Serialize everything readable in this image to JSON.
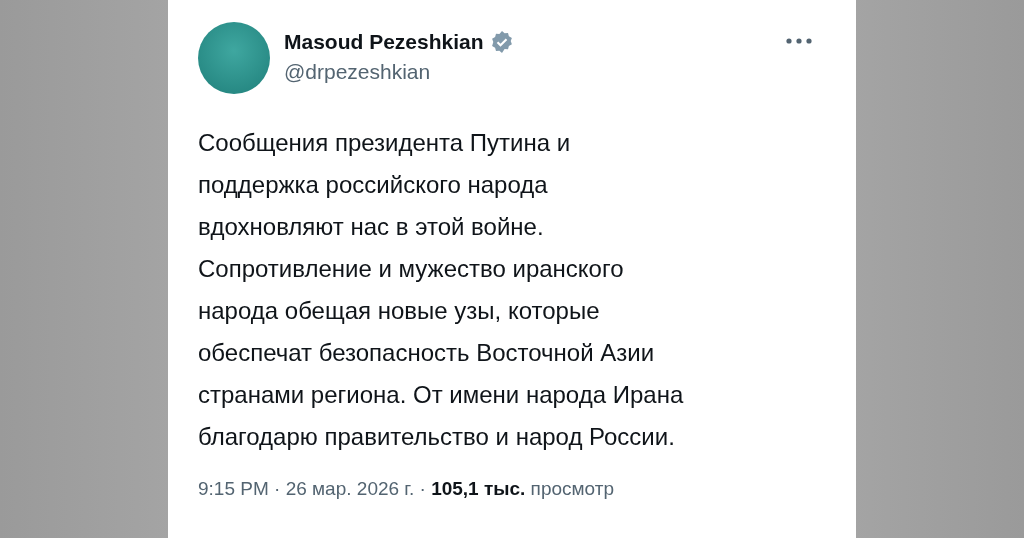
{
  "post": {
    "author": {
      "name": "Masoud Pezeshkian",
      "verified": true,
      "handle": "@drpezeshkian"
    },
    "text_lines": [
      "Сообщения президента Путина и",
      "поддержка российского народа",
      "вдохновляют нас в этой войне.",
      "Сопротивление и мужество иранского",
      "народа обещая новые узы, которые",
      "обеспечат безопасность Восточной Азии",
      "странами региона. От имени народа Ирана",
      "благодарю правительство и народ России."
    ],
    "meta": "9:15 PM · 26 мар. 2026 г. · **105,1 тыс.** просмотр"
  }
}
